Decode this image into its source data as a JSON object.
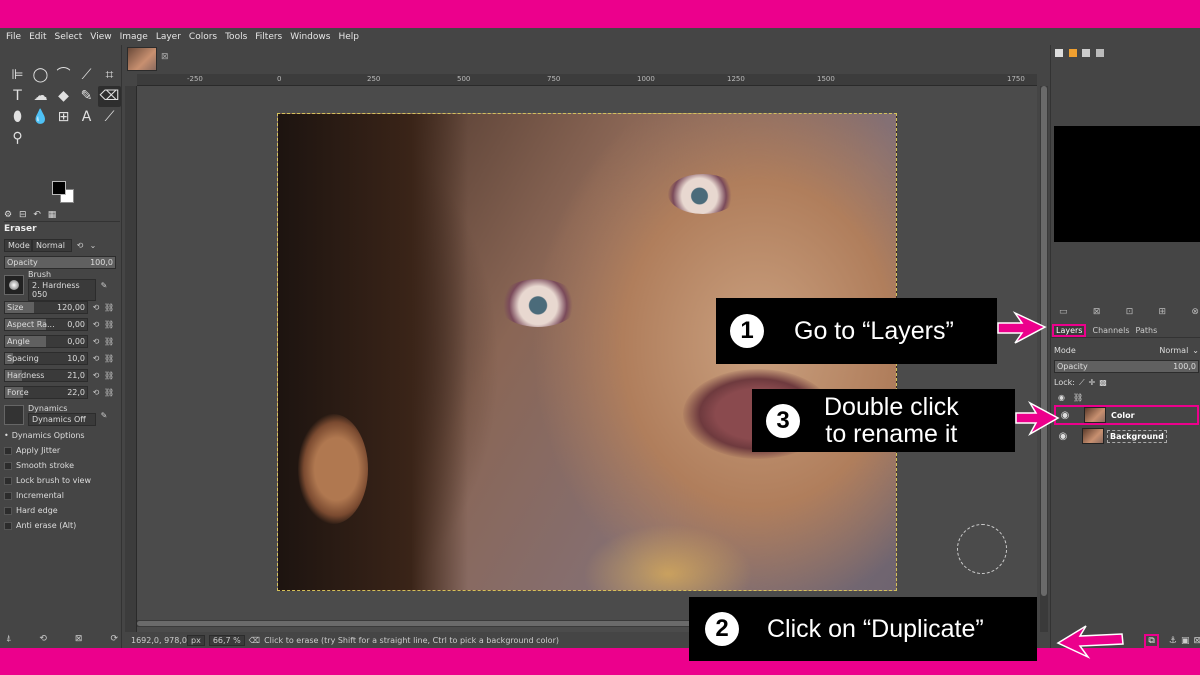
{
  "menu": [
    "File",
    "Edit",
    "Select",
    "View",
    "Image",
    "Layer",
    "Colors",
    "Tools",
    "Filters",
    "Windows",
    "Help"
  ],
  "toolbox": {
    "tools": [
      "align-tool",
      "ellipse-select-tool",
      "free-select-tool",
      "fuzzy-select-tool",
      "crop-tool",
      "text-transform-tool",
      "warp-tool",
      "bucket-fill-tool",
      "paintbrush-tool",
      "eraser-tool",
      "smudge-tool",
      "dodge-tool",
      "heal-tool",
      "text-tool",
      "color-picker-tool",
      "zoom-tool"
    ],
    "tool_glyphs": [
      "⊫",
      "◯",
      "⌒",
      "⟋",
      "⌗",
      "T",
      "☁",
      "◆",
      "✎",
      "⌫",
      "⬮",
      "💧",
      "⊞",
      "A",
      "⟋",
      "⚲"
    ],
    "fg_color": "#000000",
    "bg_color": "#ffffff"
  },
  "tool_options": {
    "title": "Eraser",
    "mode_label": "Mode",
    "mode_value": "Normal",
    "opacity": {
      "label": "Opacity",
      "value": "100,0"
    },
    "brush_label": "Brush",
    "brush_value": "2. Hardness 050",
    "sliders": [
      {
        "label": "Size",
        "value": "120,00",
        "fill": 0.35
      },
      {
        "label": "Aspect Ra...",
        "value": "0,00",
        "fill": 0.5
      },
      {
        "label": "Angle",
        "value": "0,00",
        "fill": 0.5
      },
      {
        "label": "Spacing",
        "value": "10,0",
        "fill": 0.1
      },
      {
        "label": "Hardness",
        "value": "21,0",
        "fill": 0.21
      },
      {
        "label": "Force",
        "value": "22,0",
        "fill": 0.22
      }
    ],
    "dynamics_label": "Dynamics",
    "dynamics_value": "Dynamics Off",
    "dynamics_options": "Dynamics Options",
    "checks": [
      "Apply Jitter",
      "Smooth stroke",
      "Lock brush to view",
      "Incremental",
      "Hard edge",
      "Anti erase  (Alt)"
    ]
  },
  "ruler": [
    "-250",
    "0",
    "250",
    "500",
    "750",
    "1000",
    "1250",
    "1500",
    "1750"
  ],
  "status": {
    "coords": "1692,0, 978,0",
    "unit": "px",
    "zoom": "66,7 %",
    "message": "Click to erase (try Shift for a straight line, Ctrl to pick a background color)"
  },
  "dock": {
    "tabs": {
      "layers": "Layers",
      "channels": "Channels",
      "paths": "Paths"
    },
    "mode_label": "Mode",
    "mode_value": "Normal",
    "opacity_label": "Opacity",
    "opacity_value": "100,0",
    "lock_label": "Lock:",
    "layers": [
      {
        "name": "Color"
      },
      {
        "name": "Background"
      }
    ]
  },
  "callouts": {
    "c1": {
      "num": "1",
      "text": "Go to “Layers”"
    },
    "c2": {
      "num": "2",
      "text": "Click on “Duplicate”"
    },
    "c3": {
      "num": "3",
      "line1": "Double click",
      "line2": "to rename it"
    }
  },
  "colors": {
    "accent": "#ec008c",
    "ui_bg": "#454545",
    "callout_bg": "#000000"
  }
}
